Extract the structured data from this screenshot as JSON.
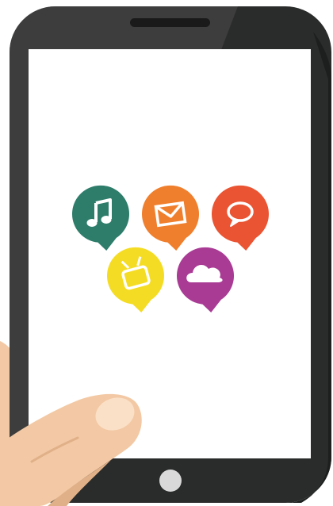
{
  "illustration": {
    "subject": "hand-holding-smartphone",
    "screen": {
      "background": "#ffffff",
      "app_icons": [
        {
          "id": "music",
          "icon": "music-note-icon",
          "color": "#2e7d6b"
        },
        {
          "id": "mail",
          "icon": "envelope-icon",
          "color": "#f07f2d"
        },
        {
          "id": "chat",
          "icon": "speech-bubble-icon",
          "color": "#ea5432"
        },
        {
          "id": "tv",
          "icon": "television-icon",
          "color": "#f5dc24"
        },
        {
          "id": "cloud",
          "icon": "cloud-icon",
          "color": "#a93b95"
        }
      ]
    },
    "colors": {
      "phone_body": "#2a2c2b",
      "phone_body_shadow": "#1d1f1e",
      "phone_highlight": "#4a4c4b",
      "speaker": "#1a1a1a",
      "home_button": "#d9d9d9",
      "skin": "#f2c9a4",
      "skin_shadow": "#e0b088",
      "nail": "#fbe0c8"
    }
  }
}
